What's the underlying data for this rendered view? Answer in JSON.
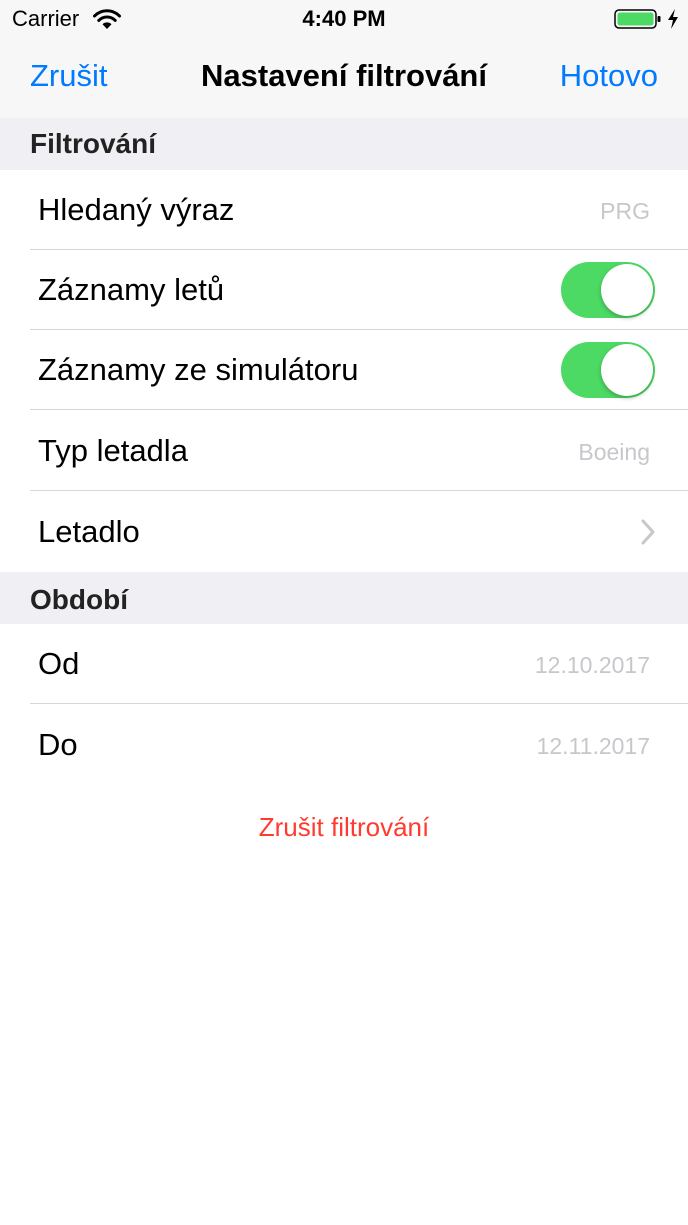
{
  "status_bar": {
    "carrier": "Carrier",
    "time": "4:40 PM",
    "icons": [
      "wifi-icon",
      "battery-icon",
      "charging-bolt-icon"
    ],
    "battery_color": "#4cd964"
  },
  "nav": {
    "left_label": "Zrušit",
    "title": "Nastavení filtrování",
    "right_label": "Hotovo",
    "accent_color": "#007aff"
  },
  "filter_section": {
    "header": "Filtrování",
    "rows": [
      {
        "label": "Hledaný výraz",
        "value": "PRG"
      },
      {
        "label": "Záznamy letů",
        "toggle_on": true
      },
      {
        "label": "Záznamy ze simulátoru",
        "toggle_on": true
      },
      {
        "label": "Typ letadla",
        "value": "Boeing"
      },
      {
        "label": "Letadlo",
        "icon": "chevron-right-icon"
      }
    ]
  },
  "period_section": {
    "header": "Období",
    "rows": [
      {
        "label": "Od",
        "value": "12.10.2017"
      },
      {
        "label": "Do",
        "value": "12.11.2017"
      }
    ]
  },
  "reset_label": "Zrušit filtrování",
  "colors": {
    "toggle_on": "#4cd964",
    "destructive": "#ff3b30",
    "placeholder": "#c7c7cc",
    "section_bg": "#efeff4"
  }
}
